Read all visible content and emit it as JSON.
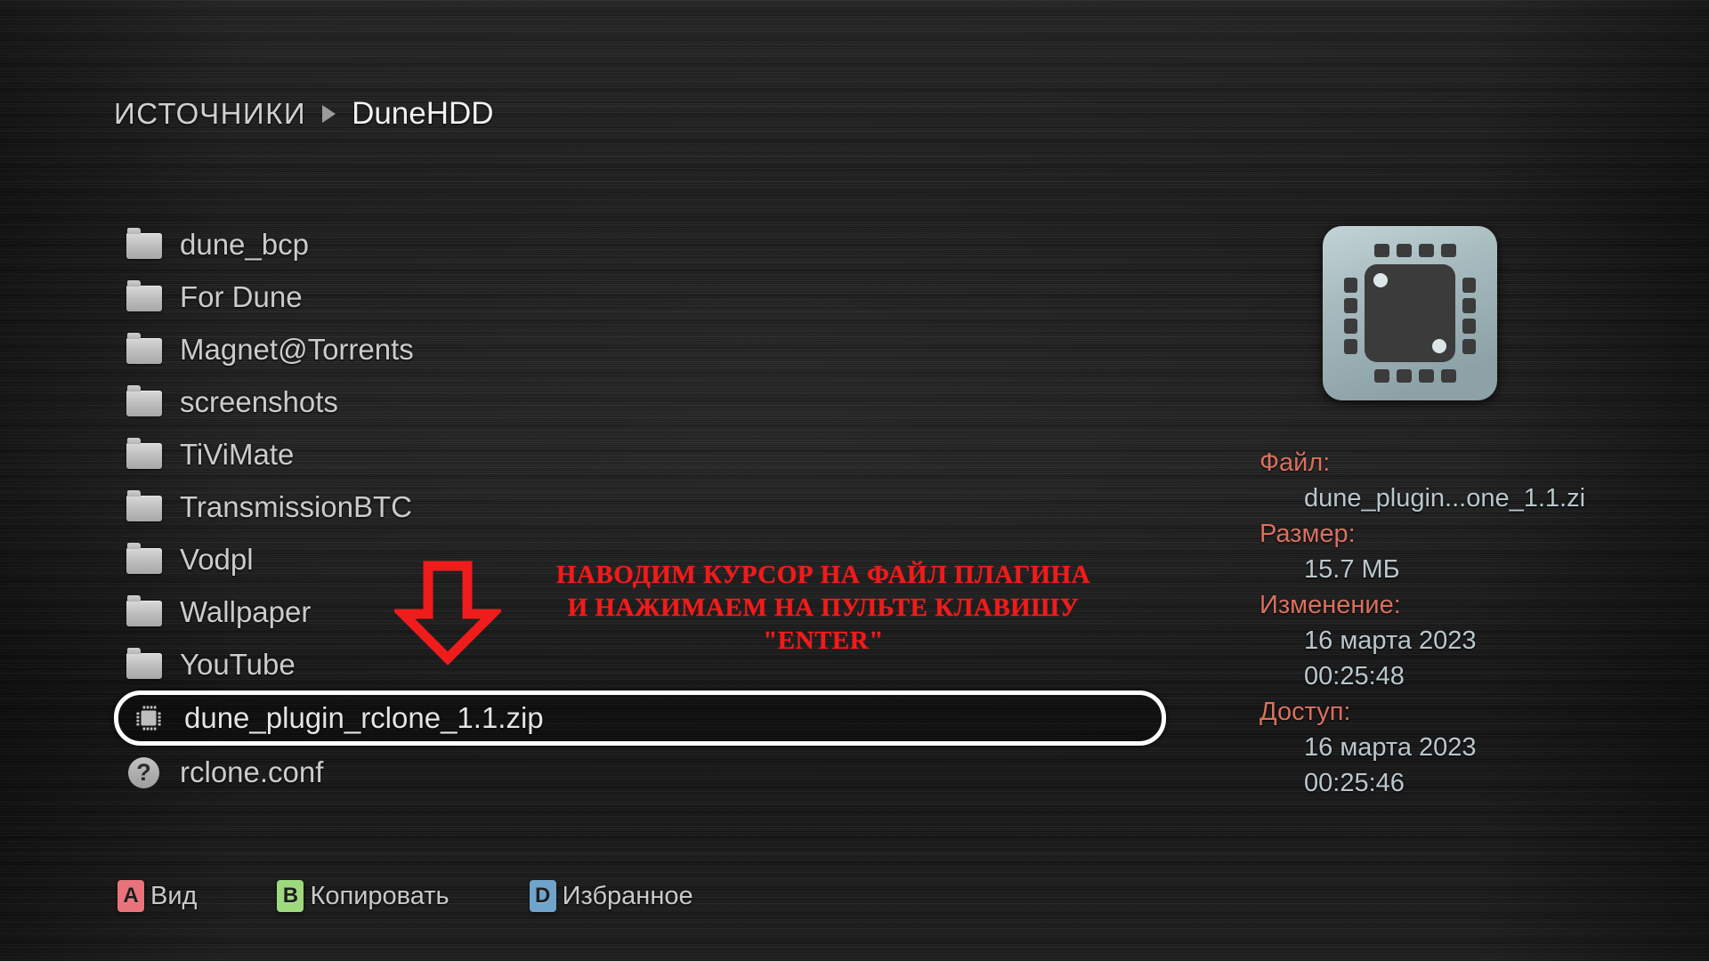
{
  "breadcrumb": {
    "root": "ИСТОЧНИКИ",
    "separator_icon": "triangle-right-icon",
    "leaf": "DuneHDD"
  },
  "file_list": [
    {
      "name": "dune_bcp",
      "icon": "folder-icon",
      "selected": false
    },
    {
      "name": "For Dune",
      "icon": "folder-icon",
      "selected": false
    },
    {
      "name": "Magnet@Torrents",
      "icon": "folder-icon",
      "selected": false
    },
    {
      "name": "screenshots",
      "icon": "folder-icon",
      "selected": false
    },
    {
      "name": "TiViMate",
      "icon": "folder-icon",
      "selected": false
    },
    {
      "name": "TransmissionBTC",
      "icon": "folder-icon",
      "selected": false
    },
    {
      "name": "Vodpl",
      "icon": "folder-icon",
      "selected": false
    },
    {
      "name": "Wallpaper",
      "icon": "folder-icon",
      "selected": false
    },
    {
      "name": "YouTube",
      "icon": "folder-icon",
      "selected": false
    },
    {
      "name": "dune_plugin_rclone_1.1.zip",
      "icon": "chip-icon",
      "selected": true
    },
    {
      "name": "rclone.conf",
      "icon": "question-mark-icon",
      "selected": false
    }
  ],
  "annotation": {
    "icon": "red-down-arrow-icon",
    "color": "#f01b1b",
    "lines": [
      "НАВОДИМ КУРСОР НА ФАЙЛ ПЛАГИНА",
      "И НАЖИМАЕМ НА ПУЛЬТЕ КЛАВИШУ",
      "\"ENTER\""
    ]
  },
  "info_panel": {
    "preview_icon": "chip-icon-large",
    "label_color": "#d9705f",
    "value_color": "#b9c7cd",
    "fields": [
      {
        "label": "Файл:",
        "value": "dune_plugin...one_1.1.zi"
      },
      {
        "label": "Размер:",
        "value": "15.7 МБ"
      },
      {
        "label": "Изменение:",
        "value": "16 марта 2023",
        "value2": "00:25:48"
      },
      {
        "label": "Доступ:",
        "value": "16 марта 2023",
        "value2": "00:25:46"
      }
    ]
  },
  "key_bar": [
    {
      "key": "A",
      "label": "Вид",
      "color": "#e8737a"
    },
    {
      "key": "B",
      "label": "Копировать",
      "color": "#9ed97e"
    },
    {
      "key": "D",
      "label": "Избранное",
      "color": "#6fa3cc"
    }
  ]
}
